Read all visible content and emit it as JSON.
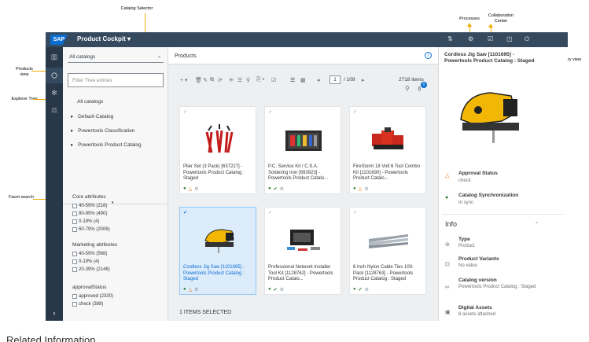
{
  "annotations": {
    "catalog_selector": "Catalog Selector",
    "processes": "Processes",
    "collaboration_center": "Collaboration Center",
    "summary_view": "Summary view",
    "products_view": "Products view",
    "explorer_tree": "Explorer Tree",
    "facet_search": "Facet search"
  },
  "shell": {
    "logo": "SAP",
    "title": "Product Cockpit ▾"
  },
  "explorer": {
    "catalog_select": "All catalogs",
    "filter_placeholder": "Filter Tree entries",
    "tree": [
      "All catalogs",
      "Default-Catalog",
      "Powertools Classification",
      "Powertools Product Catalog"
    ],
    "facets": [
      {
        "title": "Core attributes",
        "items": [
          "40-59% (218)",
          "80-99% (490)",
          "0-19% (4)",
          "60-79% (2006)"
        ]
      },
      {
        "title": "Marketing attributes",
        "items": [
          "40-59% (568)",
          "0-19% (4)",
          "20-39% (2146)"
        ]
      },
      {
        "title": "approvalStatus",
        "items": [
          "approved (2330)",
          "check (388)"
        ]
      }
    ]
  },
  "main": {
    "header": "Products",
    "page_value": "1",
    "page_total": "/ 109",
    "items_count": "2718 items",
    "notification_count": "0",
    "cards": [
      {
        "title": "Plier Set (3 Pack) [637227] - Powertools Product Catalog : Staged",
        "status": "warn"
      },
      {
        "title": "P.C. Service Kit / C.S.A. Soldering Iron [693923] - Powertools Product Catalo...",
        "status": "ok"
      },
      {
        "title": "FireStorm 18 Volt 6 Tool Combo Kit [1101690] - Powertools Product Catalo...",
        "status": "warn"
      },
      {
        "title": "Cordless Jig Saw [1101695] - Powertools Product Catalog : Staged",
        "status": "warn"
      },
      {
        "title": "Professional Network Installer Tool Kit [1128762] - Powertools Product Catalo...",
        "status": "ok"
      },
      {
        "title": "6 Inch Nylon Cable Ties 100-Pack [1128763] - Powertools Product Catalog : Staged",
        "status": "ok"
      }
    ],
    "selection_status": "1 ITEMS SELECTED"
  },
  "summary": {
    "title": "Cordless Jig Saw [1101695] - Powertools Product Catalog : Staged",
    "approval_label": "Approval Status",
    "approval_value": "check",
    "sync_label": "Catalog Synchronization",
    "sync_value": "In sync",
    "info_header": "Info",
    "type_label": "Type",
    "type_value": "Product",
    "variants_label": "Product Variants",
    "variants_value": "No value",
    "catalog_label": "Catalog version",
    "catalog_value": "Powertools Product Catalog : Staged",
    "assets_label": "Digital Assets",
    "assets_value": "8 assets attached"
  },
  "footer_heading": "Related Information",
  "colors": {
    "shellbar": "#354a5f",
    "nav": "#283848",
    "accent": "#0a6ed1",
    "annotation_arrow": "#f0ab00",
    "warning": "#e9730c",
    "success": "#2b7d2b"
  }
}
